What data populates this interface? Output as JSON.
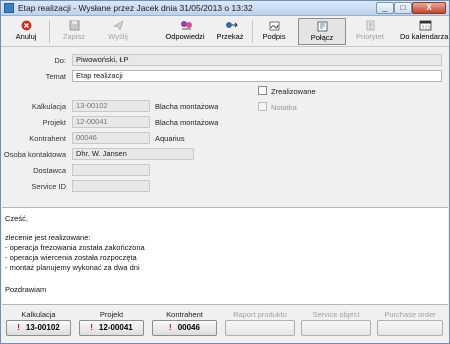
{
  "window": {
    "title": "Etap realizacji - Wysłane przez Jacek dnia 31/05/2013 o 13:32",
    "min": "_",
    "max": "□",
    "close": "X"
  },
  "toolbar": {
    "anuluj": "Anuluj",
    "zapisz": "Zapisz",
    "wyslij": "Wyślij",
    "odpowiedzi": "Odpowiedzi",
    "przekaz": "Przekaż",
    "podpis": "Podpis",
    "polacz": "Połącz",
    "priorytet": "Priorytet",
    "do_kalendarza": "Do kalendarza"
  },
  "header": {
    "do_label": "Do:",
    "do_value": "Piwowoński, ŁP",
    "temat_label": "Temat",
    "temat_value": "Etap realizacji"
  },
  "details": {
    "kalkulacja_label": "Kalkulacja",
    "kalkulacja_value": "13-00102",
    "kalkulacja_desc": "Blacha montażowa",
    "projekt_label": "Projekt",
    "projekt_value": "12-00041",
    "projekt_desc": "Blacha montażowa",
    "kontrahent_label": "Kontrahent",
    "kontrahent_value": "00046",
    "kontrahent_desc": "Aquarius",
    "osoba_label": "Osoba kontaktowa",
    "osoba_value": "Dhr. W. Jansen",
    "dostawca_label": "Dostawca",
    "dostawca_value": "",
    "service_label": "Service ID",
    "service_value": "",
    "zrealizowane": "Zrealizowane",
    "notatka": "Notatka"
  },
  "message": {
    "lines": [
      "Cześć,",
      "",
      "zlecenie jest realizowane:",
      "- operacja frezowania została zakończona",
      "- operacja wiercenia została rozpoczęta",
      "- montaż planujemy wykonać za dwa dni",
      "",
      "Pozdrawiam"
    ]
  },
  "footer": {
    "kalkulacja_label": "Kalkulacja",
    "kalkulacja_btn": "13-00102",
    "projekt_label": "Projekt",
    "projekt_btn": "12-00041",
    "kontrahent_label": "Kontrahent",
    "kontrahent_btn": "00046",
    "raport_label": "Raport produktu",
    "service_label": "Service object",
    "purchase_label": "Purchase order",
    "excl": "!"
  },
  "icons": {
    "anuluj": "cancel-icon",
    "zapisz": "save-icon",
    "wyslij": "send-icon",
    "odpowiedzi": "reply-icon",
    "przekaz": "forward-icon",
    "podpis": "signature-icon",
    "polacz": "link-icon",
    "priorytet": "priority-icon",
    "do_kalendarza": "calendar-icon"
  },
  "colors": {
    "accent_red": "#c01010",
    "titlebar": "#bcd3ec"
  }
}
